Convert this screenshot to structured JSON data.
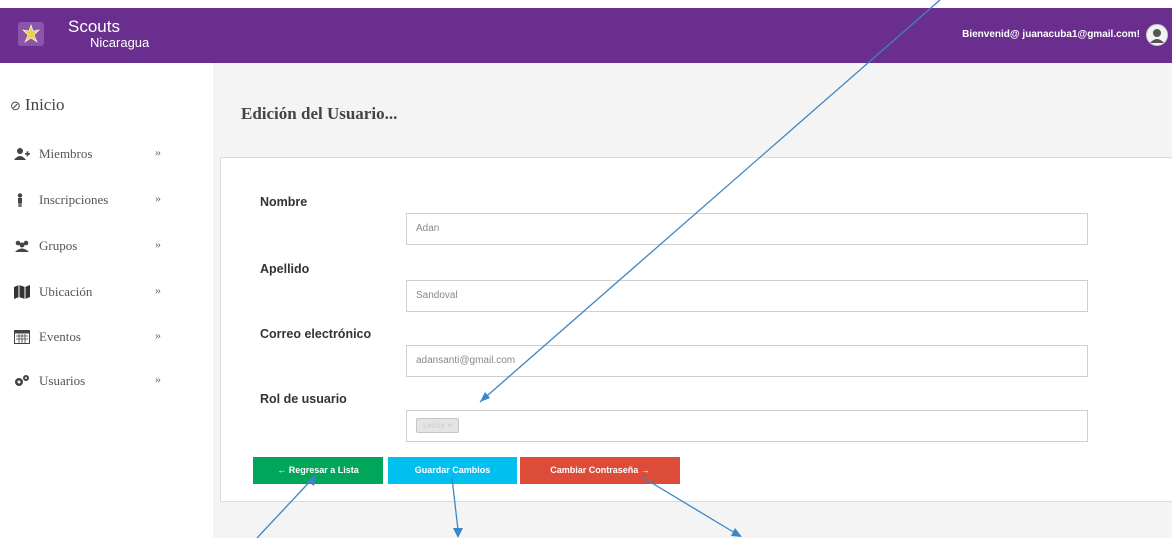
{
  "header": {
    "brand_line1": "Scouts",
    "brand_line2": "Nicaragua",
    "welcome_text": "Bienvenid@ juanacuba1@gmail.com!",
    "bar_color": "#6a2f8e"
  },
  "sidebar": {
    "home_label": "Inicio",
    "items": [
      {
        "label": "Miembros",
        "icon": "user-plus-icon"
      },
      {
        "label": "Inscripciones",
        "icon": "person-icon"
      },
      {
        "label": "Grupos",
        "icon": "users-icon"
      },
      {
        "label": "Ubicación",
        "icon": "map-icon"
      },
      {
        "label": "Eventos",
        "icon": "calendar-icon"
      },
      {
        "label": "Usuarios",
        "icon": "gears-icon"
      }
    ]
  },
  "main": {
    "title": "Edición del Usuario...",
    "form": {
      "nombre_label": "Nombre",
      "nombre_value": "Adan",
      "apellido_label": "Apellido",
      "apellido_value": "Sandoval",
      "correo_label": "Correo electrónico",
      "correo_value": "adansanti@gmail.com",
      "rol_label": "Rol de usuario",
      "rol_tag": "Lector ×"
    },
    "buttons": {
      "back": "← Regresar a Lista",
      "save": "Guardar Cambios",
      "change_password": "Cambiar Contraseña →"
    }
  },
  "colors": {
    "green": "#00a65a",
    "blue": "#00c0ef",
    "red": "#dd4b39"
  }
}
